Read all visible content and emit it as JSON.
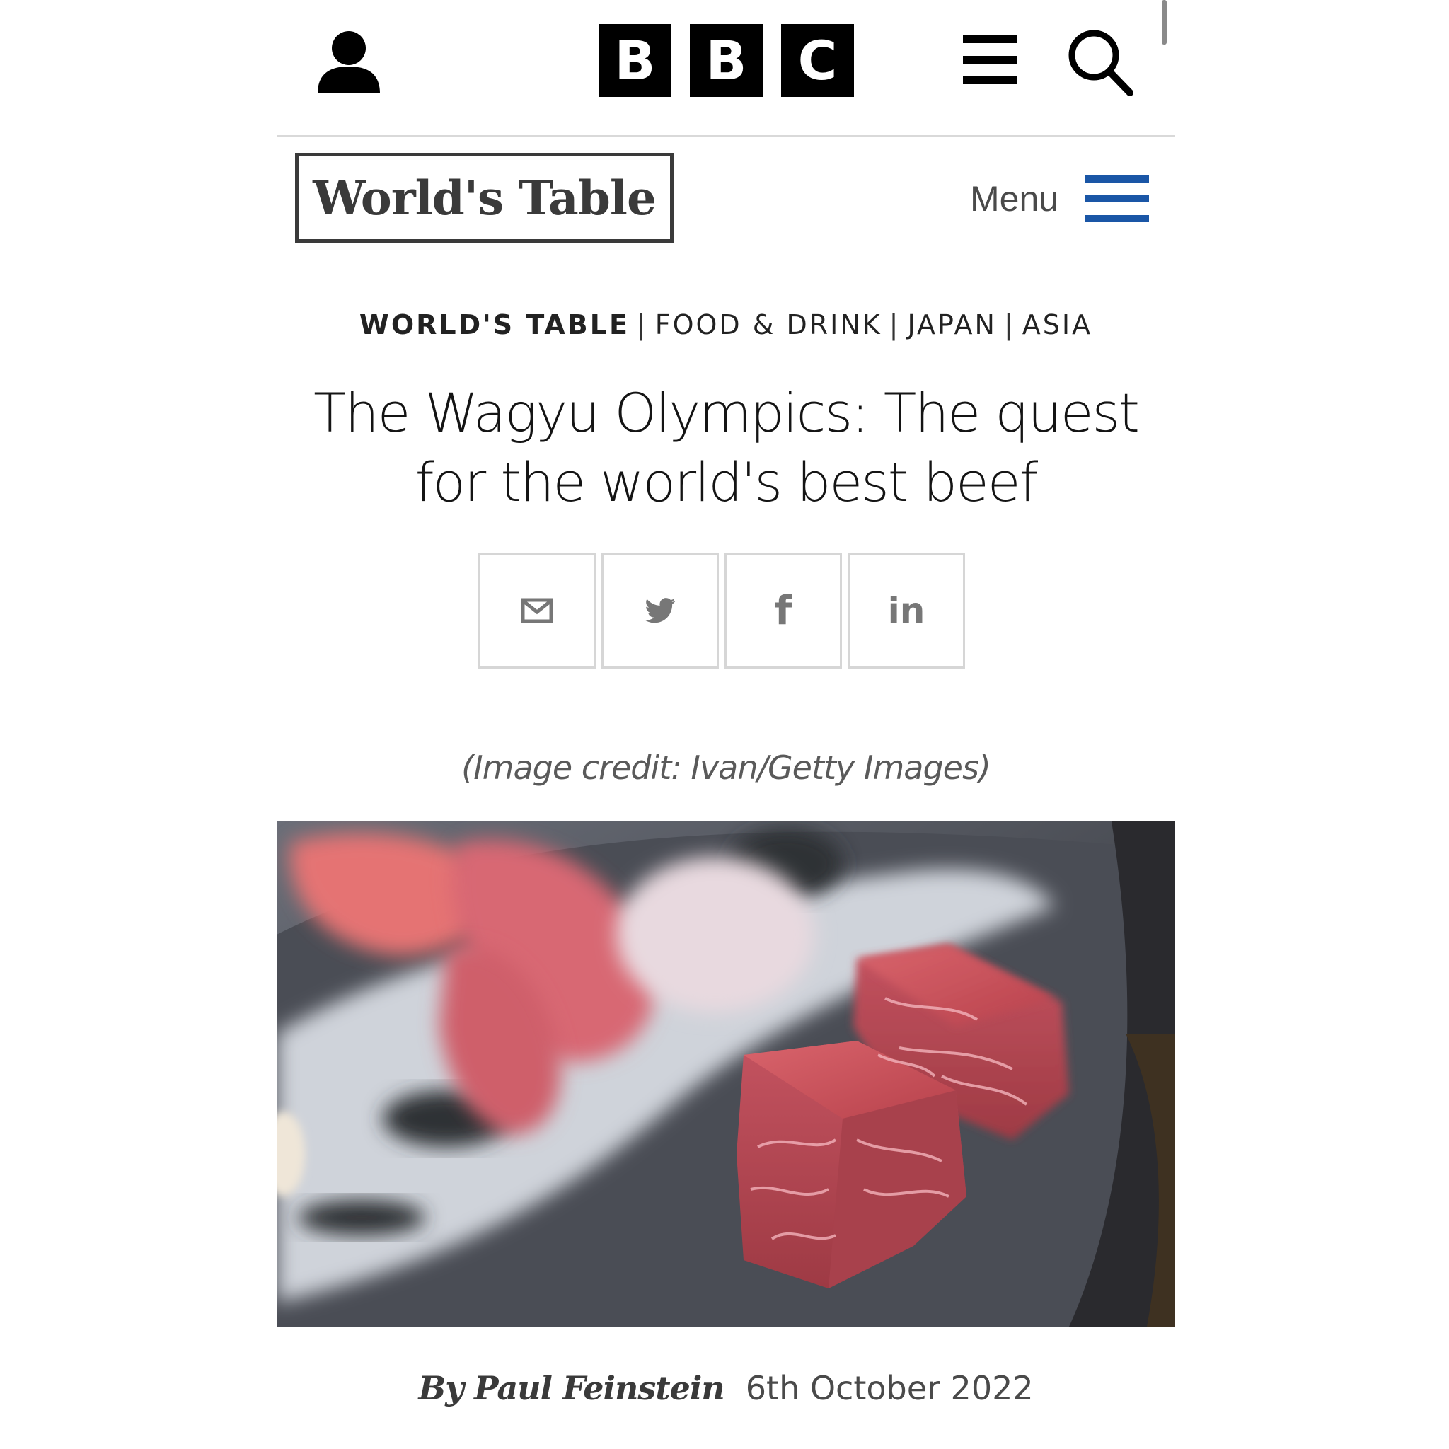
{
  "header": {
    "account_icon": "user-account-icon",
    "logo_letters": [
      "B",
      "B",
      "C"
    ],
    "menu_icon": "hamburger-menu-icon",
    "search_icon": "search-icon"
  },
  "section": {
    "logo_text": "World's Table",
    "menu_label": "Menu",
    "menu_color": "#1a56a6"
  },
  "breadcrumb": {
    "items": [
      "WORLD'S TABLE",
      "FOOD & DRINK",
      "JAPAN",
      "ASIA"
    ],
    "separator": "|"
  },
  "article": {
    "title_line1": "The Wagyu Olympics: The quest",
    "title_line2": "for the world's best beef",
    "image_credit": "(Image credit: Ivan/Getty Images)",
    "author": "By Paul Feinstein",
    "date": "6th October 2022"
  },
  "share": {
    "buttons": [
      {
        "icon": "email-icon"
      },
      {
        "icon": "twitter-icon"
      },
      {
        "icon": "facebook-icon",
        "glyph": "f"
      },
      {
        "icon": "linkedin-icon",
        "glyph": "in"
      }
    ]
  }
}
